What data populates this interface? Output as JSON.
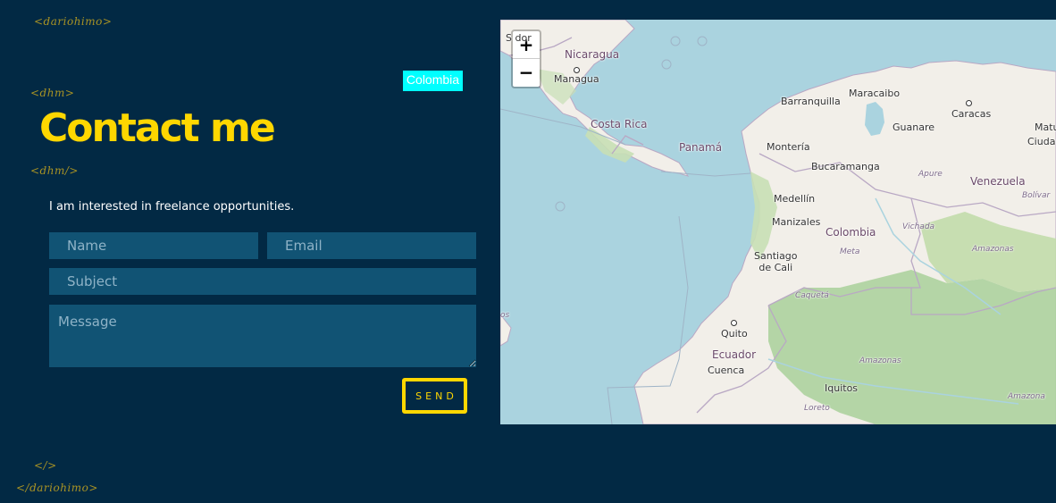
{
  "tags": {
    "top": "<dariohimo>",
    "h_open": "<dhm>",
    "h_close": "<dhm/>",
    "close_small": "</>",
    "bottom": "</dariohimo>"
  },
  "page_title": "Contact me",
  "tooltip": "Colombia",
  "intro": "I am interested in freelance opportunities.",
  "form": {
    "name_placeholder": "Name",
    "email_placeholder": "Email",
    "subject_placeholder": "Subject",
    "message_placeholder": "Message",
    "send_label": "SEND"
  },
  "map": {
    "zoom_in": "+",
    "zoom_out": "−",
    "labels": {
      "salvador": "S  dor",
      "nicaragua": "Nicaragua",
      "managua": "Managua",
      "costa_rica": "Costa Rica",
      "panama": "Panamá",
      "barranquilla": "Barranquilla",
      "maracaibo": "Maracaibo",
      "caracas": "Caracas",
      "matur": "Matur",
      "ciudad": "Ciudad C",
      "guanare": "Guanare",
      "monteria": "Montería",
      "bucaramanga": "Bucaramanga",
      "apure": "Apure",
      "venezuela": "Venezuela",
      "bolivar": "Bolívar",
      "medellin": "Medellín",
      "manizales": "Manizales",
      "colombia": "Colombia",
      "vichada": "Vichada",
      "meta": "Meta",
      "amazonas_ve": "Amazonas",
      "santiago_cali": "Santiago\nde Cali",
      "caqueta": "Caquetá",
      "quito": "Quito",
      "ecuador": "Ecuador",
      "cuenca": "Cuenca",
      "amazonas_co": "Amazonas",
      "iquitos": "Iquitos",
      "loreto": "Loreto",
      "amazona": "Amazona",
      "os": "os"
    }
  },
  "colors": {
    "background": "#022944",
    "accent": "#ffd700",
    "field": "#115374",
    "tag": "#a99324",
    "tooltip": "#00ffff",
    "sea": "#aad3df",
    "land": "#f2efe9",
    "forest": "#add19e"
  }
}
